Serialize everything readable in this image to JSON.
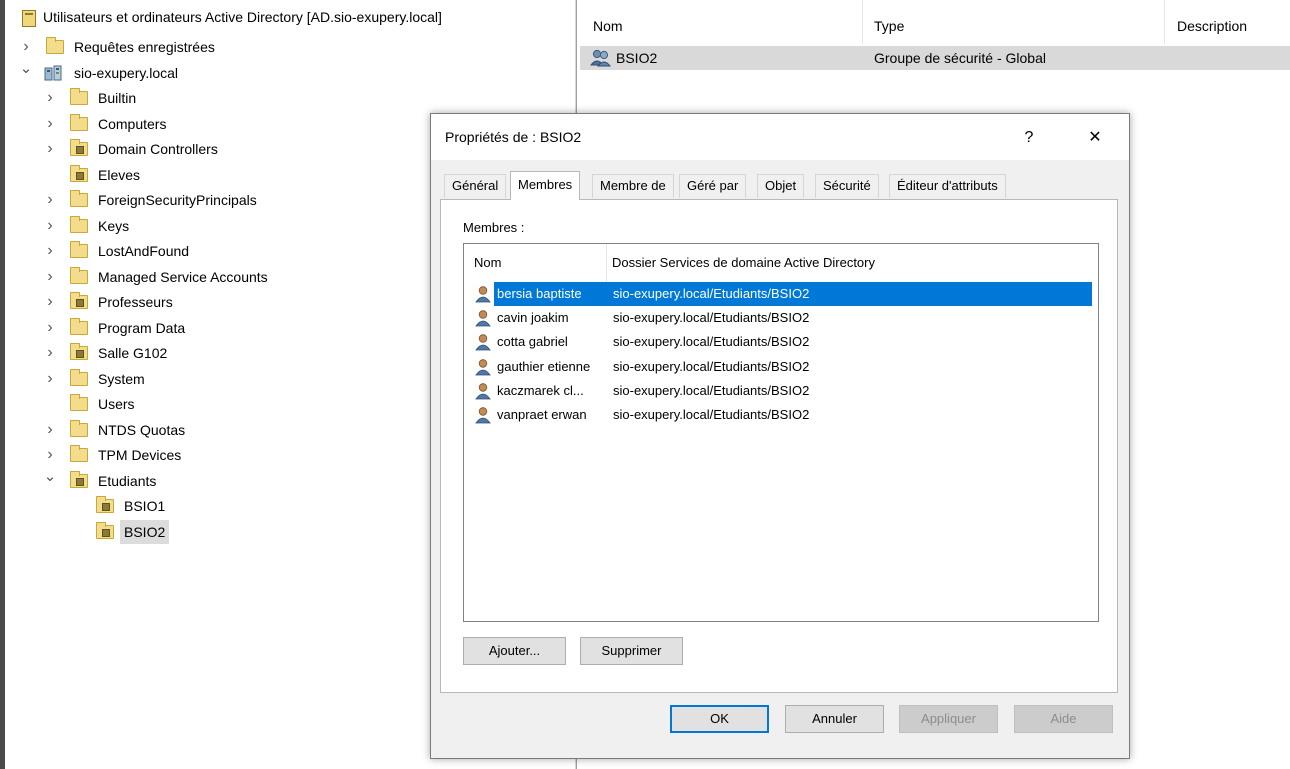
{
  "tree": {
    "root": "Utilisateurs et ordinateurs Active Directory [AD.sio-exupery.local]",
    "items": [
      {
        "label": "Requêtes enregistrées",
        "level": 0,
        "expander": "collapsed",
        "icon": "folder"
      },
      {
        "label": "sio-exupery.local",
        "level": 0,
        "expander": "expanded",
        "icon": "domain"
      },
      {
        "label": "Builtin",
        "level": 1,
        "expander": "collapsed",
        "icon": "folder"
      },
      {
        "label": "Computers",
        "level": 1,
        "expander": "collapsed",
        "icon": "folder"
      },
      {
        "label": "Domain Controllers",
        "level": 1,
        "expander": "collapsed",
        "icon": "ou-folder"
      },
      {
        "label": "Eleves",
        "level": 1,
        "expander": "none",
        "icon": "ou-folder"
      },
      {
        "label": "ForeignSecurityPrincipals",
        "level": 1,
        "expander": "collapsed",
        "icon": "folder"
      },
      {
        "label": "Keys",
        "level": 1,
        "expander": "collapsed",
        "icon": "folder"
      },
      {
        "label": "LostAndFound",
        "level": 1,
        "expander": "collapsed",
        "icon": "folder"
      },
      {
        "label": "Managed Service Accounts",
        "level": 1,
        "expander": "collapsed",
        "icon": "folder"
      },
      {
        "label": "Professeurs",
        "level": 1,
        "expander": "collapsed",
        "icon": "ou-folder"
      },
      {
        "label": "Program Data",
        "level": 1,
        "expander": "collapsed",
        "icon": "folder"
      },
      {
        "label": "Salle G102",
        "level": 1,
        "expander": "collapsed",
        "icon": "ou-folder"
      },
      {
        "label": "System",
        "level": 1,
        "expander": "collapsed",
        "icon": "folder"
      },
      {
        "label": "Users",
        "level": 1,
        "expander": "none",
        "icon": "folder"
      },
      {
        "label": "NTDS Quotas",
        "level": 1,
        "expander": "collapsed",
        "icon": "folder"
      },
      {
        "label": "TPM Devices",
        "level": 1,
        "expander": "collapsed",
        "icon": "folder"
      },
      {
        "label": "Etudiants",
        "level": 1,
        "expander": "expanded",
        "icon": "ou-folder"
      },
      {
        "label": "BSIO1",
        "level": 2,
        "expander": "none",
        "icon": "ou-folder"
      },
      {
        "label": "BSIO2",
        "level": 2,
        "expander": "none",
        "icon": "ou-folder",
        "selected": true
      }
    ]
  },
  "list": {
    "columns": [
      "Nom",
      "Type",
      "Description"
    ],
    "rows": [
      {
        "name": "BSIO2",
        "type": "Groupe de sécurité - Global",
        "description": "",
        "icon": "group-icon"
      }
    ]
  },
  "dialog": {
    "title": "Propriétés de : BSIO2",
    "help_glyph": "?",
    "close_glyph": "✕",
    "tabs": [
      {
        "label": "Général"
      },
      {
        "label": "Membres",
        "active": true
      },
      {
        "label": "Membre de"
      },
      {
        "label": "Géré par"
      },
      {
        "label": "Objet"
      },
      {
        "label": "Sécurité"
      },
      {
        "label": "Éditeur d'attributs"
      }
    ],
    "members_label": "Membres :",
    "members_columns": [
      "Nom",
      "Dossier Services de domaine Active Directory"
    ],
    "members": [
      {
        "name": "bersia baptiste",
        "folder": "sio-exupery.local/Etudiants/BSIO2",
        "selected": true
      },
      {
        "name": "cavin joakim",
        "folder": "sio-exupery.local/Etudiants/BSIO2"
      },
      {
        "name": "cotta gabriel",
        "folder": "sio-exupery.local/Etudiants/BSIO2"
      },
      {
        "name": "gauthier etienne",
        "folder": "sio-exupery.local/Etudiants/BSIO2"
      },
      {
        "name": "kaczmarek cl...",
        "folder": "sio-exupery.local/Etudiants/BSIO2"
      },
      {
        "name": "vanpraet erwan",
        "folder": "sio-exupery.local/Etudiants/BSIO2"
      }
    ],
    "buttons": {
      "add": "Ajouter...",
      "remove": "Supprimer",
      "ok": "OK",
      "cancel": "Annuler",
      "apply": "Appliquer",
      "help": "Aide"
    }
  },
  "colors": {
    "selection": "#0078d7",
    "folder": "#f3dc8c",
    "dialog_bg": "#f0f0f0"
  }
}
